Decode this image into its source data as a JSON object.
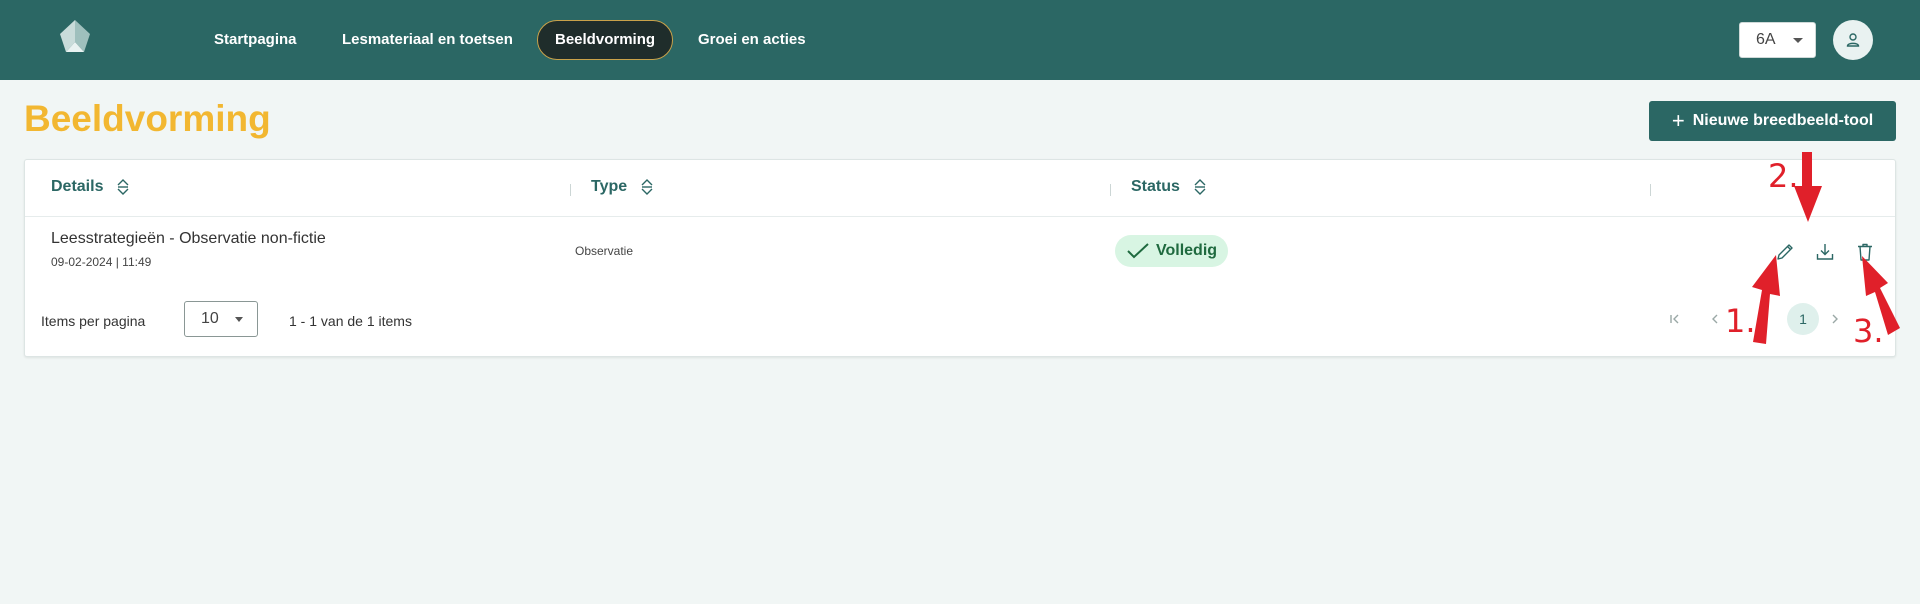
{
  "header": {
    "nav": [
      {
        "label": "Startpagina",
        "active": false
      },
      {
        "label": "Lesmateriaal en toetsen",
        "active": false
      },
      {
        "label": "Beeldvorming",
        "active": true
      },
      {
        "label": "Groei en acties",
        "active": false
      }
    ],
    "class_selector": {
      "value": "6A"
    },
    "icons": {
      "logo": "logo-icon",
      "avatar": "user-icon",
      "dropdown": "caret-down-icon"
    }
  },
  "page": {
    "title": "Beeldvorming",
    "new_button_label": "Nieuwe breedbeeld-tool",
    "new_button_icon": "plus-icon"
  },
  "table": {
    "columns": [
      {
        "label": "Details",
        "sortable": true
      },
      {
        "label": "Type",
        "sortable": true
      },
      {
        "label": "Status",
        "sortable": true
      }
    ],
    "rows": [
      {
        "title": "Leesstrategieën - Observatie non-fictie",
        "date": "09-02-2024 | 11:49",
        "type": "Observatie",
        "status": "Volledig",
        "actions": [
          "pencil-icon",
          "download-icon",
          "trash-icon"
        ]
      }
    ]
  },
  "pagination": {
    "items_per_page_label": "Items per pagina",
    "items_per_page_value": "10",
    "range_text": "1 - 1 van de 1 items",
    "current_page": "1"
  },
  "annotations": {
    "labels": [
      "1.",
      "2.",
      "3."
    ],
    "color": "#e0202a"
  },
  "colors": {
    "primary": "#2b6764",
    "accent_title": "#f2b731",
    "status_bg": "#d8f5e3",
    "status_text": "#1f6a3f",
    "background": "#f1f6f5"
  }
}
